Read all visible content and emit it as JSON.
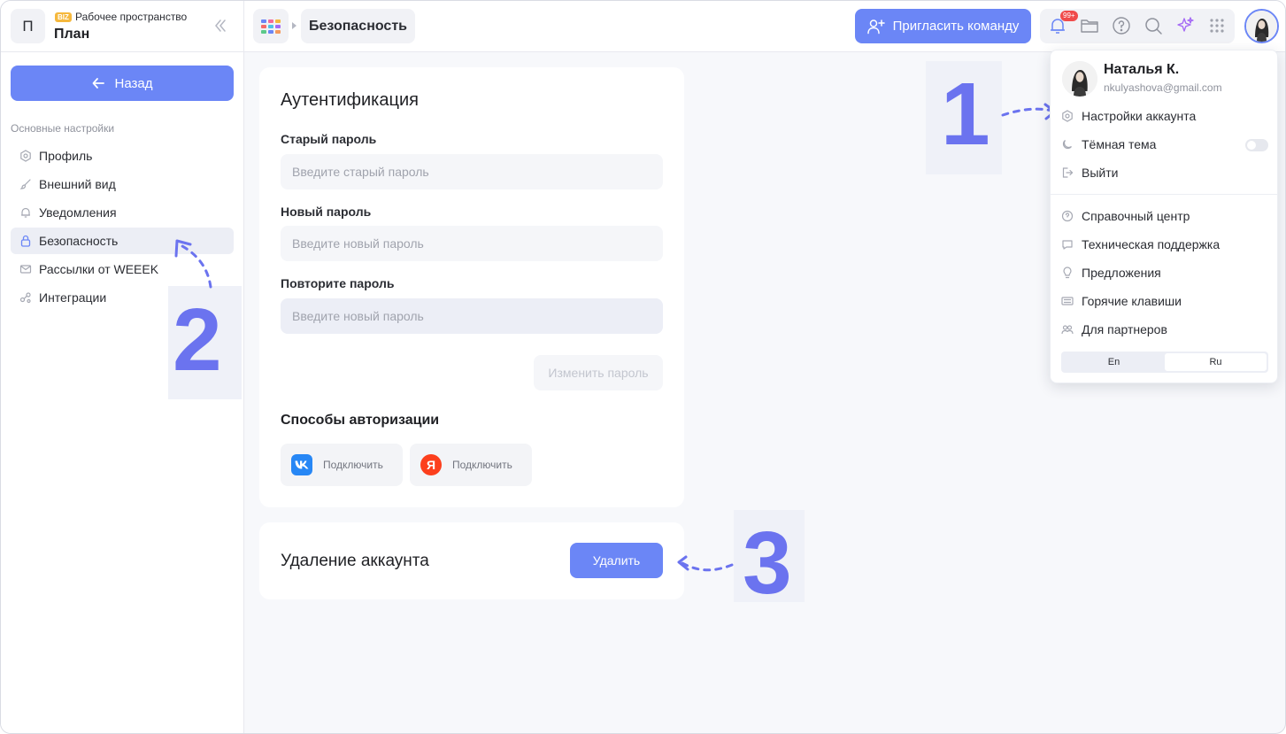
{
  "workspace": {
    "initial": "П",
    "badge": "BIZ",
    "label": "Рабочее пространство",
    "name": "План"
  },
  "sidebar": {
    "back_label": "Назад",
    "section_title": "Основные настройки",
    "items": [
      {
        "label": "Профиль",
        "icon": "gear-icon"
      },
      {
        "label": "Внешний вид",
        "icon": "brush-icon"
      },
      {
        "label": "Уведомления",
        "icon": "bell-icon"
      },
      {
        "label": "Безопасность",
        "icon": "lock-icon",
        "active": true
      },
      {
        "label": "Рассылки от WEEEK",
        "icon": "mail-icon"
      },
      {
        "label": "Интеграции",
        "icon": "integrations-icon"
      }
    ]
  },
  "header": {
    "breadcrumb": "Безопасность",
    "invite_label": "Пригласить команду",
    "notifications_count": "99+"
  },
  "auth": {
    "title": "Аутентификация",
    "old_password_label": "Старый пароль",
    "old_password_placeholder": "Введите старый пароль",
    "new_password_label": "Новый пароль",
    "new_password_placeholder": "Введите новый пароль",
    "repeat_password_label": "Повторите пароль",
    "repeat_password_placeholder": "Введите новый пароль",
    "change_button": "Изменить пароль",
    "methods_title": "Способы авторизации",
    "vk_label": "Подключить",
    "yandex_label": "Подключить",
    "yandex_glyph": "Я"
  },
  "delete": {
    "title": "Удаление аккаунта",
    "button": "Удалить"
  },
  "user_menu": {
    "name": "Наталья К.",
    "email": "nkulyashova@gmail.com",
    "items_top": [
      {
        "label": "Настройки аккаунта",
        "icon": "gear-icon"
      },
      {
        "label": "Тёмная тема",
        "icon": "moon-icon"
      },
      {
        "label": "Выйти",
        "icon": "logout-icon"
      }
    ],
    "items_bottom": [
      {
        "label": "Справочный центр",
        "icon": "help-icon"
      },
      {
        "label": "Техническая поддержка",
        "icon": "chat-icon"
      },
      {
        "label": "Предложения",
        "icon": "bulb-icon"
      },
      {
        "label": "Горячие клавиши",
        "icon": "keyboard-icon"
      },
      {
        "label": "Для партнеров",
        "icon": "partners-icon"
      }
    ],
    "lang_en": "En",
    "lang_ru": "Ru"
  },
  "annotations": {
    "one": "1",
    "two": "2",
    "three": "3"
  },
  "colors": {
    "accent": "#6b86f6",
    "annotation": "#6b73ef",
    "badge": "#f04b4b"
  }
}
